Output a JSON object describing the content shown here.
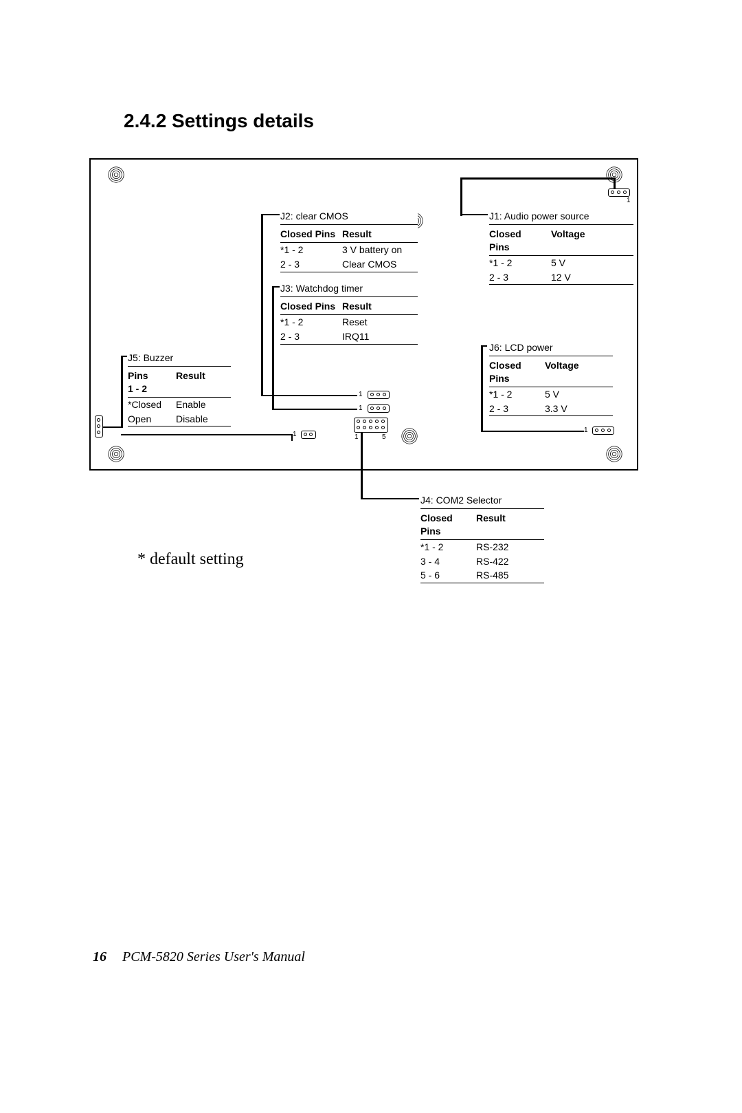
{
  "section_title": "2.4.2 Settings details",
  "default_note": "* default setting",
  "footer": {
    "page_num": "16",
    "manual": "PCM-5820 Series  User's Manual"
  },
  "j2": {
    "title": "J2:  clear CMOS",
    "h1": "Closed Pins",
    "h2": "Result",
    "rows": [
      {
        "c1": "*1 - 2",
        "c2": "3 V battery on"
      },
      {
        "c1": "2 - 3",
        "c2": "Clear CMOS"
      }
    ]
  },
  "j3": {
    "title": "J3:  Watchdog timer",
    "h1": "Closed Pins",
    "h2": "Result",
    "rows": [
      {
        "c1": "*1 - 2",
        "c2": "Reset"
      },
      {
        "c1": "2 - 3",
        "c2": "IRQ11"
      }
    ]
  },
  "j5": {
    "title": "J5:  Buzzer",
    "h1a": "Pins",
    "h1b": "1 - 2",
    "h2": "Result",
    "rows": [
      {
        "c1": "*Closed",
        "c2": "Enable"
      },
      {
        "c1": "Open",
        "c2": "Disable"
      }
    ]
  },
  "j1": {
    "title": "J1:  Audio power source",
    "h1a": "Closed",
    "h1b": "Pins",
    "h2": "Voltage",
    "rows": [
      {
        "c1": "*1 - 2",
        "c2": "5 V"
      },
      {
        "c1": "2 - 3",
        "c2": "12 V"
      }
    ]
  },
  "j6": {
    "title": "J6:  LCD power",
    "h1a": "Closed",
    "h1b": "Pins",
    "h2": "Voltage",
    "rows": [
      {
        "c1": "*1 - 2",
        "c2": "5 V"
      },
      {
        "c1": "2 - 3",
        "c2": "3.3 V"
      }
    ]
  },
  "j4": {
    "title": "J4:  COM2 Selector",
    "h1a": "Closed",
    "h1b": "Pins",
    "h2": "Result",
    "rows": [
      {
        "c1": "*1 - 2",
        "c2": "RS-232"
      },
      {
        "c1": " 3 - 4",
        "c2": "RS-422"
      },
      {
        "c1": " 5 - 6",
        "c2": "RS-485"
      }
    ]
  },
  "pin_labels": {
    "one": "1",
    "five": "5"
  }
}
